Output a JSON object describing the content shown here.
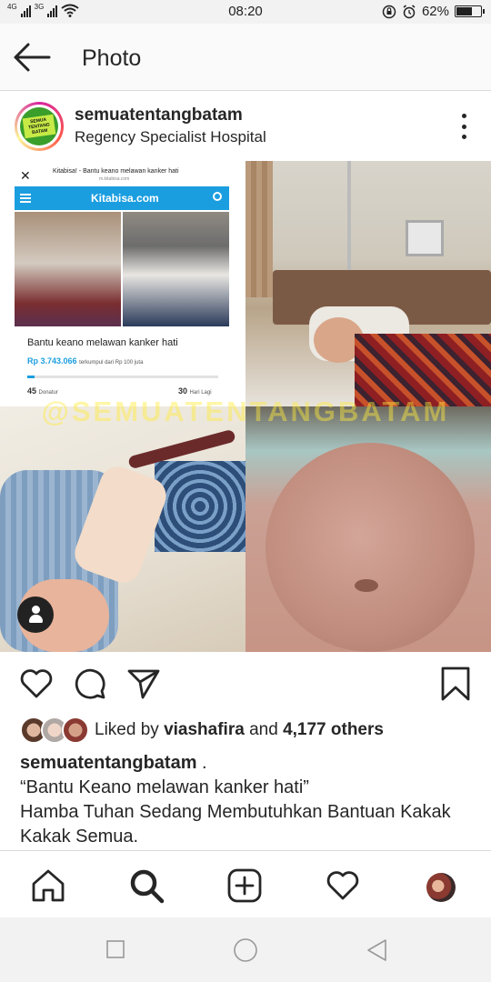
{
  "status_bar": {
    "network_1": "4G",
    "network_2": "3G",
    "time": "08:20",
    "battery_percent": "62%",
    "battery_level": 0.62
  },
  "header": {
    "title": "Photo"
  },
  "post": {
    "username": "semuatentangbatam",
    "location": "Regency Specialist Hospital",
    "avatar_logo_text": "SEMUA TENTANG BATAM",
    "watermark": "@SEMUATENTANGBATAM",
    "screenshot": {
      "page_title": "Kitabisa! - Bantu keano melawan kanker hati",
      "url": "m.kitabisa.com",
      "brand": "Kitabisa.com",
      "campaign_title": "Bantu keano melawan kanker hati",
      "amount": "Rp 3.743.066",
      "amount_suffix": "terkumpul dari Rp 100 juta",
      "progress_fraction": 0.04,
      "donors_count": "45",
      "donors_label": "Donatur",
      "days_count": "30",
      "days_label": "Hari Lagi"
    },
    "likes": {
      "prefix": "Liked by",
      "user": "viashafira",
      "middle": "and",
      "others": "4,177 others"
    },
    "caption": {
      "user": "semuatentangbatam",
      "suffix": " .",
      "line1": "“Bantu Keano melawan kanker hati”",
      "line2": "Hamba Tuhan Sedang Membutuhkan Bantuan Kakak Kakak Semua."
    }
  },
  "icons": {
    "back": "arrow-left-icon",
    "more": "more-vertical-icon",
    "like": "heart-icon",
    "comment": "comment-icon",
    "share": "send-icon",
    "save": "bookmark-icon",
    "home": "home-icon",
    "search": "search-icon",
    "new_post": "plus-square-icon",
    "activity": "heart-icon",
    "profile": "avatar"
  },
  "colors": {
    "kitabisa_blue": "#1b9ee0",
    "watermark_yellow": "#ffeb3b",
    "text": "#262626"
  }
}
